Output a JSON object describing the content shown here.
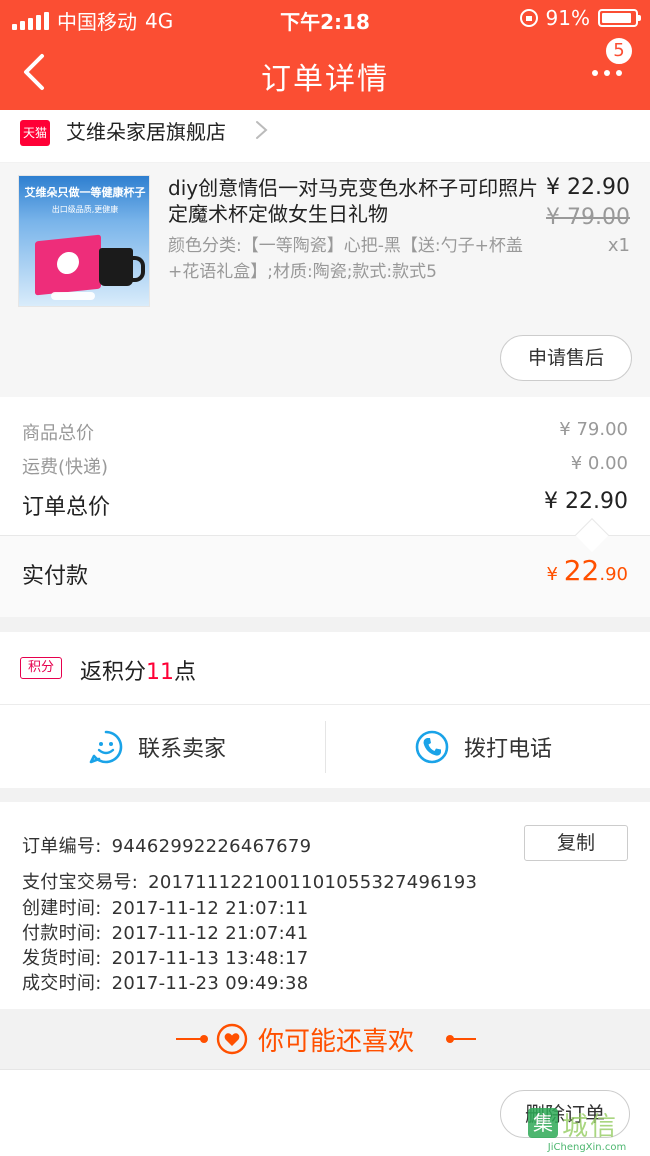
{
  "status_bar": {
    "carrier": "中国移动",
    "network": "4G",
    "time": "下午2:18",
    "battery": "91%",
    "battery_level": 0.91
  },
  "nav": {
    "title": "订单详情",
    "badge_count": "5"
  },
  "store": {
    "badge": "天猫",
    "name": "艾维朵家居旗舰店"
  },
  "product": {
    "image_banner": "艾维朵只做一等健康杯子",
    "image_sub": "出口级品质,更健康",
    "title": "diy创意情侣一对马克变色水杯子可印照片定魔术杯定做女生日礼物",
    "sku": "颜色分类:【一等陶瓷】心把-黑【送:勺子+杯盖+花语礼盒】;材质:陶瓷;款式:款式5",
    "price": "¥ 22.90",
    "original_price": "¥ 79.00",
    "quantity": "x1",
    "after_sale_button": "申请售后"
  },
  "summary": {
    "goods_total_label": "商品总价",
    "goods_total_value": "¥ 79.00",
    "shipping_label": "运费(快递)",
    "shipping_value": "¥ 0.00",
    "order_total_label": "订单总价",
    "order_total_value": "¥ 22.90",
    "paid_label": "实付款",
    "paid_currency": "¥ ",
    "paid_int": "22",
    "paid_dec": ".90"
  },
  "points": {
    "tag": "积分",
    "prefix": "返积分",
    "count": "11",
    "suffix": "点"
  },
  "contact": {
    "seller_label": "联系卖家",
    "call_label": "拨打电话"
  },
  "order_info": {
    "copy_button": "复制",
    "rows": [
      {
        "key": "订单编号:",
        "value": "94462992226467679"
      },
      {
        "key": "支付宝交易号:",
        "value": "20171112210011010553274961​93"
      },
      {
        "key": "创建时间:",
        "value": "2017-11-12 21:07:11"
      },
      {
        "key": "付款时间:",
        "value": "2017-11-12 21:07:41"
      },
      {
        "key": "发货时间:",
        "value": "2017-11-13 13:48:17"
      },
      {
        "key": "成交时间:",
        "value": "2017-11-23 09:49:38"
      }
    ]
  },
  "recommend": {
    "title": "你可能还喜欢"
  },
  "bottom": {
    "delete_button": "删除订单",
    "watermark_cn": "城信",
    "watermark_url": "JiChengXin.com"
  },
  "colors": {
    "brand_red": "#fb4e33",
    "accent_orange": "#ff5000",
    "tmall_red": "#ff0036",
    "contact_blue": "#1aa3e8"
  }
}
